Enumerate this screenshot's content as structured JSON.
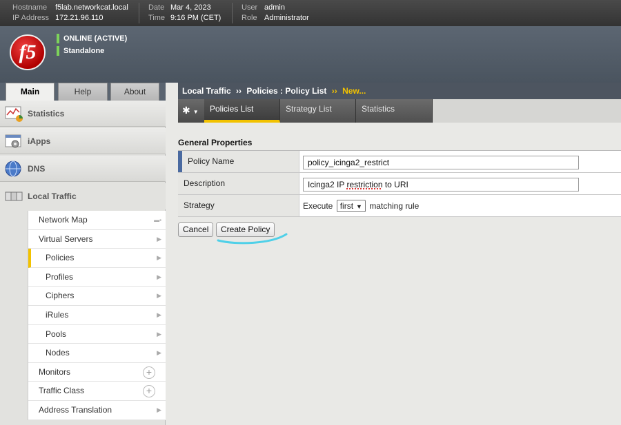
{
  "topbar": {
    "hostname_label": "Hostname",
    "hostname": "f5lab.networkcat.local",
    "ip_label": "IP Address",
    "ip": "172.21.96.110",
    "date_label": "Date",
    "date": "Mar 4, 2023",
    "time_label": "Time",
    "time": "9:16 PM (CET)",
    "user_label": "User",
    "user": "admin",
    "role_label": "Role",
    "role": "Administrator"
  },
  "banner": {
    "logo_text": "f5",
    "status": "ONLINE (ACTIVE)",
    "mode": "Standalone",
    "status_color": "#7dd35a"
  },
  "left_tabs": [
    "Main",
    "Help",
    "About"
  ],
  "sidebar": {
    "sections": [
      {
        "label": "Statistics",
        "icon": "statistics-icon"
      },
      {
        "label": "iApps",
        "icon": "iapps-icon"
      },
      {
        "label": "DNS",
        "icon": "dns-globe-icon"
      },
      {
        "label": "Local Traffic",
        "icon": "local-traffic-icon"
      }
    ],
    "items": [
      {
        "label": "Network Map"
      },
      {
        "label": "Virtual Servers"
      },
      {
        "label": "Policies"
      },
      {
        "label": "Profiles"
      },
      {
        "label": "Ciphers"
      },
      {
        "label": "iRules"
      },
      {
        "label": "Pools"
      },
      {
        "label": "Nodes"
      },
      {
        "label": "Monitors"
      },
      {
        "label": "Traffic Class"
      },
      {
        "label": "Address Translation"
      }
    ]
  },
  "breadcrumb": {
    "part1": "Local Traffic",
    "sep": "››",
    "part2": "Policies : Policy List",
    "part3": "New..."
  },
  "tabs": [
    "Policies List",
    "Strategy List",
    "Statistics"
  ],
  "form": {
    "section_title": "General Properties",
    "policy_name_label": "Policy Name",
    "policy_name_value": "policy_icinga2_restrict",
    "description_label": "Description",
    "description_value": "Icinga2 IP restriction to URI",
    "strategy_label": "Strategy",
    "strategy_prefix": "Execute",
    "strategy_value": "first",
    "strategy_suffix": "matching rule"
  },
  "buttons": {
    "cancel": "Cancel",
    "create": "Create Policy"
  },
  "colors": {
    "accent": "#f2c200",
    "required_marker": "#4a6aa0",
    "annotation": "#4fd0e8"
  }
}
